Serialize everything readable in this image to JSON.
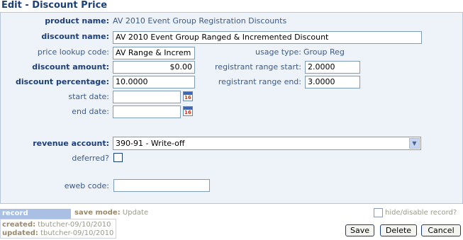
{
  "page": {
    "title": "Edit - Discount Price"
  },
  "form": {
    "product_name_label": "product name:",
    "product_name_value": "AV 2010 Event Group Registration Discounts",
    "discount_name_label": "discount name:",
    "discount_name_value": "AV 2010 Event Group Ranged & Incremented Discount",
    "price_lookup_label": "price lookup code:",
    "price_lookup_value": "AV Range & Increm",
    "usage_type_label": "usage type:",
    "usage_type_value": "Group Reg",
    "discount_amount_label": "discount amount:",
    "discount_amount_value": "$0.00",
    "range_start_label": "registrant range start:",
    "range_start_value": "2.0000",
    "discount_percentage_label": "discount percentage:",
    "discount_percentage_value": "10.0000",
    "range_end_label": "registrant range end:",
    "range_end_value": "3.0000",
    "start_date_label": "start date:",
    "start_date_value": "",
    "end_date_label": "end date:",
    "end_date_value": "",
    "calendar_day": "16",
    "revenue_account_label": "revenue account:",
    "revenue_account_value": "390-91 - Write-off",
    "deferred_label": "deferred?",
    "eweb_code_label": "eweb code:",
    "eweb_code_value": ""
  },
  "footer": {
    "record_information_label": "record information",
    "save_mode_label": "save mode:",
    "save_mode_value": "Update",
    "hide_disable_label": "hide/disable record?",
    "created_label": "created:",
    "created_value": "tbutcher-09/10/2010",
    "updated_label": "updated:",
    "updated_value": "tbutcher-09/10/2010"
  },
  "buttons": {
    "save": "Save",
    "delete": "Delete",
    "cancel": "Cancel"
  },
  "icons": {
    "calendar": "calendar-icon",
    "dropdown": "chevron-down-icon"
  },
  "colors": {
    "heading": "#1c3f7a",
    "label": "#3d5a8a",
    "panel": "#eef3fa",
    "record_tag": "#a9c0e4"
  }
}
